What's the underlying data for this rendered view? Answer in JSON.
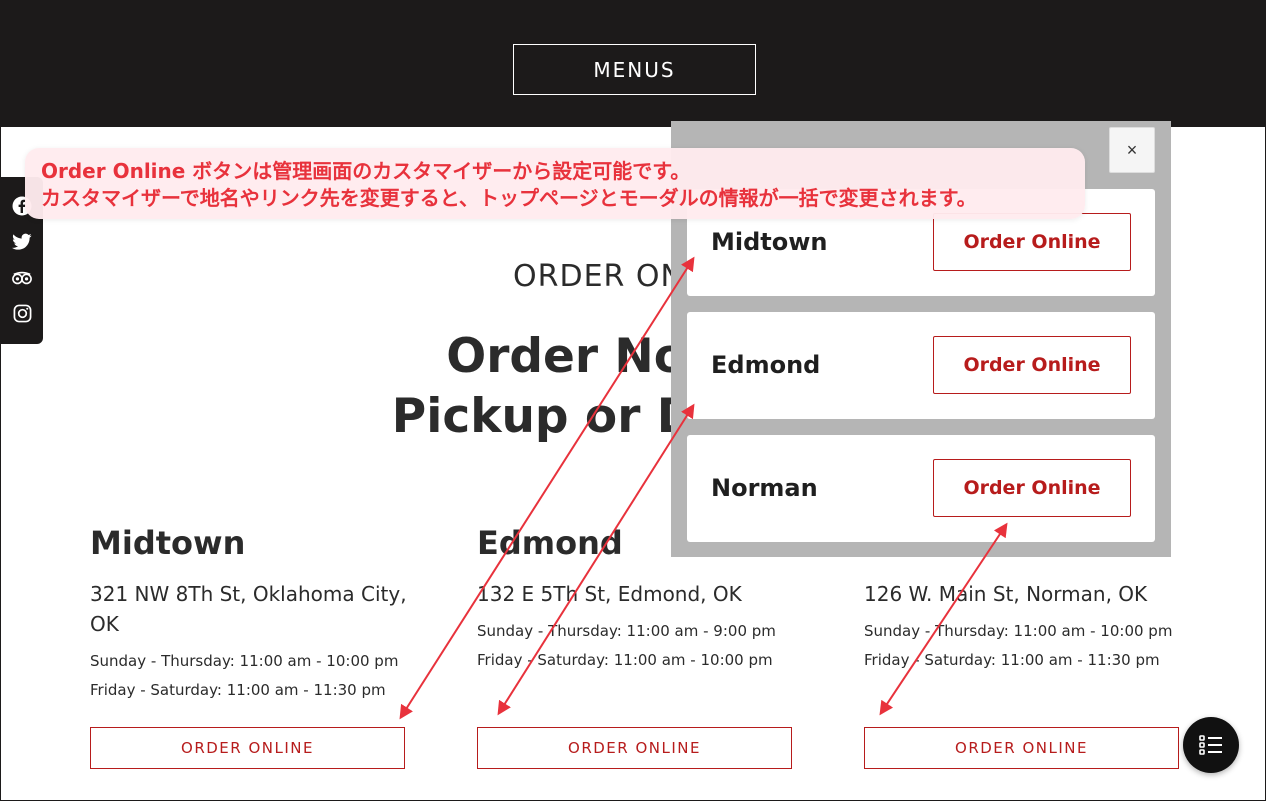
{
  "header": {
    "menus_label": "MENUS"
  },
  "social": {
    "icons": [
      "facebook-icon",
      "twitter-icon",
      "tripadvisor-icon",
      "instagram-icon"
    ]
  },
  "section": {
    "eyebrow": "ORDER ONLINE",
    "title_line1": "Order Now for",
    "title_line2": "Pickup or Delivery"
  },
  "locations": [
    {
      "name": "Midtown",
      "address": "321 NW 8Th St, Oklahoma City, OK",
      "hours1": "Sunday - Thursday: 11:00 am - 10:00 pm",
      "hours2": "Friday - Saturday: 11:00 am - 11:30 pm",
      "button": "ORDER ONLINE"
    },
    {
      "name": "Edmond",
      "address": "132 E 5Th St, Edmond, OK",
      "hours1": "Sunday - Thursday: 11:00 am - 9:00 pm",
      "hours2": "Friday - Saturday: 11:00 am - 10:00 pm",
      "button": "ORDER ONLINE"
    },
    {
      "name": "Norman",
      "address": "126 W. Main St, Norman, OK",
      "hours1": "Sunday - Thursday: 11:00 am - 10:00 pm",
      "hours2": "Friday - Saturday: 11:00 am - 11:30 pm",
      "button": "ORDER ONLINE"
    }
  ],
  "modal": {
    "close_label": "×",
    "items": [
      {
        "name": "Midtown",
        "button": "Order Online"
      },
      {
        "name": "Edmond",
        "button": "Order Online"
      },
      {
        "name": "Norman",
        "button": "Order Online"
      }
    ]
  },
  "annotation": {
    "line1": "Order Online ボタンは管理画面のカスタマイザーから設定可能です。",
    "line2": "カスタマイザーで地名やリンク先を変更すると、トップページとモーダルの情報が一括で変更されます。"
  },
  "colors": {
    "header_bg": "#1c1a1a",
    "accent_red": "#b71c1c",
    "annotation_red": "#e8323c",
    "annotation_bg": "#ffebee",
    "modal_backdrop": "#b5b5b5"
  },
  "fab": {
    "icon": "list-icon"
  }
}
